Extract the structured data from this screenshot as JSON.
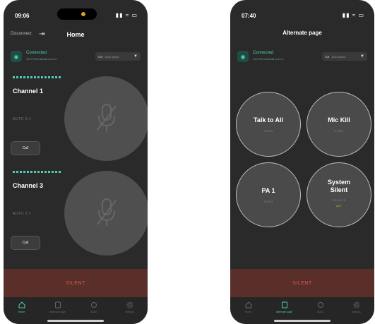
{
  "left": {
    "status": {
      "time": "09:06",
      "icons": "▮▮ ≈ ▭"
    },
    "topbar": {
      "disconnect_label": "Disconnect",
      "title": "Home"
    },
    "connection": {
      "status": "Connected",
      "detail": "12:0 FW Intercall at v1.0",
      "select_label": "Auto select"
    },
    "channels": [
      {
        "name": "Channel 1",
        "mode": "AUTO 0:1",
        "button_label": "Call"
      },
      {
        "name": "Channel 3",
        "mode": "AUTO 2:1",
        "button_label": "Call"
      }
    ],
    "silent_label": "SILENT"
  },
  "right": {
    "status": {
      "time": "07:40",
      "icons": "▮▮ ≈ ▭"
    },
    "title": "Alternate page",
    "connection": {
      "status": "Connected",
      "detail": "12:0 FW Intercall at v1.0",
      "select_label": "Auto select"
    },
    "buttons": [
      {
        "label": "Talk to All",
        "mode": "PUSH"
      },
      {
        "label": "Mic Kill",
        "mode": "PUSH"
      },
      {
        "label": "PA 1",
        "mode": "PUSH"
      },
      {
        "label": "System Silent",
        "mode": "TOGGLE",
        "state": "ACT"
      }
    ],
    "silent_label": "SILENT"
  },
  "tabs": [
    {
      "label": "Home"
    },
    {
      "label": "Alternate page"
    },
    {
      "label": "Audio"
    },
    {
      "label": "Settings"
    }
  ],
  "colors": {
    "accent": "#4fd0b5",
    "background": "#2a2a2a",
    "silent_bar": "#5a2f2a",
    "silent_text": "#d65a4c",
    "toggle_state": "#d8b23a"
  }
}
